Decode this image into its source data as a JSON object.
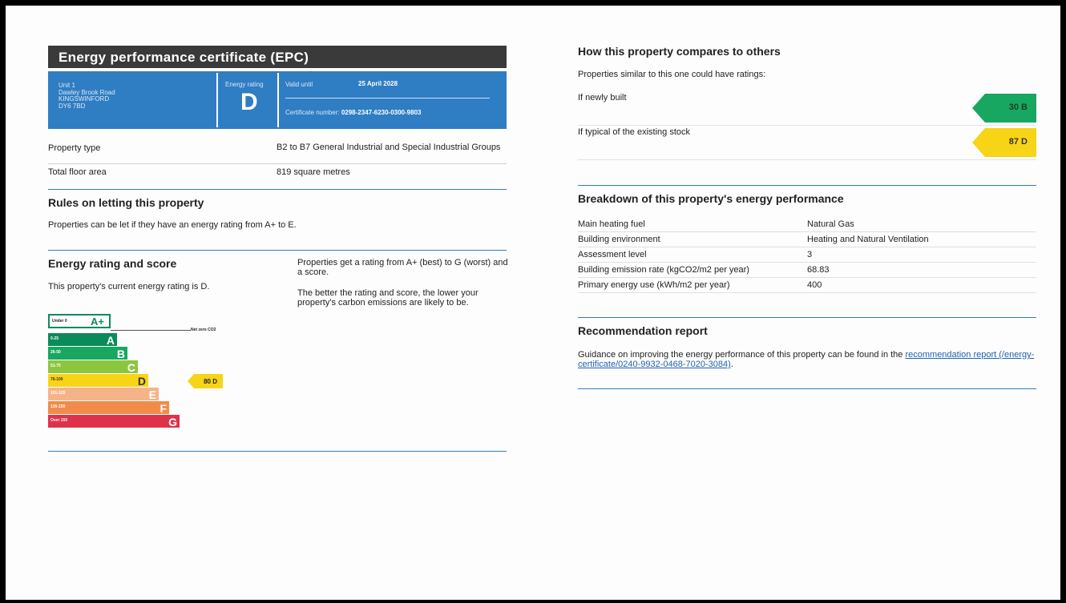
{
  "header": {
    "title": "Energy performance certificate (EPC)"
  },
  "summary": {
    "address": [
      "Unit 1",
      "Dawley Brook Road",
      "KINGSWINFORD",
      "DY6 7BD"
    ],
    "energy_rating_label": "Energy rating",
    "energy_rating": "D",
    "valid_until_label": "Valid until",
    "valid_until": "25 April 2028",
    "certificate_label": "Certificate number:",
    "certificate_number": "0298-2347-6230-0300-9803"
  },
  "property": [
    {
      "label": "Property type",
      "value": "B2 to B7 General Industrial and Special Industrial Groups"
    },
    {
      "label": "Total floor area",
      "value": "819 square metres"
    }
  ],
  "rules": {
    "heading": "Rules on letting this property",
    "text": "Properties can be let if they have an energy rating from A+ to E."
  },
  "rating_score": {
    "heading": "Energy rating and score",
    "current": "This property's current energy rating is D.",
    "explain1": "Properties get a rating from A+ (best) to G (worst) and a score.",
    "explain2": "The better the rating and score, the lower your property's carbon emissions are likely to be."
  },
  "scale": {
    "bands": [
      {
        "range": "Under 0",
        "letter": "A+",
        "color": "#ffffff"
      },
      {
        "range": "0-25",
        "letter": "A",
        "color": "#0c8a5a"
      },
      {
        "range": "26-50",
        "letter": "B",
        "color": "#18a760"
      },
      {
        "range": "51-75",
        "letter": "C",
        "color": "#8cc63f"
      },
      {
        "range": "76-100",
        "letter": "D",
        "color": "#f7d416"
      },
      {
        "range": "101-125",
        "letter": "E",
        "color": "#f5b38a"
      },
      {
        "range": "126-150",
        "letter": "F",
        "color": "#f28b4a"
      },
      {
        "range": "Over 150",
        "letter": "G",
        "color": "#e0314b"
      }
    ],
    "net_zero_label": "Net zero CO2",
    "current_marker": "80 D"
  },
  "compare": {
    "heading": "How this property compares to others",
    "intro": "Properties similar to this one could have ratings:",
    "new_label": "If newly built",
    "new_value": "30 B",
    "new_color": "#18a760",
    "typical_label": "If typical of the existing stock",
    "typical_value": "87 D",
    "typical_color": "#f7d416"
  },
  "breakdown": {
    "heading": "Breakdown of this property's energy performance",
    "rows": [
      {
        "label": "Main heating fuel",
        "value": "Natural Gas"
      },
      {
        "label": "Building environment",
        "value": "Heating and Natural Ventilation"
      },
      {
        "label": "Assessment level",
        "value": "3"
      },
      {
        "label": "Building emission rate (kgCO2/m2 per year)",
        "value": "68.83"
      },
      {
        "label": "Primary energy use (kWh/m2 per year)",
        "value": "400"
      }
    ]
  },
  "recommendation": {
    "heading": "Recommendation report",
    "text": "Guidance on improving the energy performance of this property can be found in the ",
    "link_text": "recommendation report (/energy-certificate/0240-9932-0468-7020-3084)",
    "end": "."
  }
}
